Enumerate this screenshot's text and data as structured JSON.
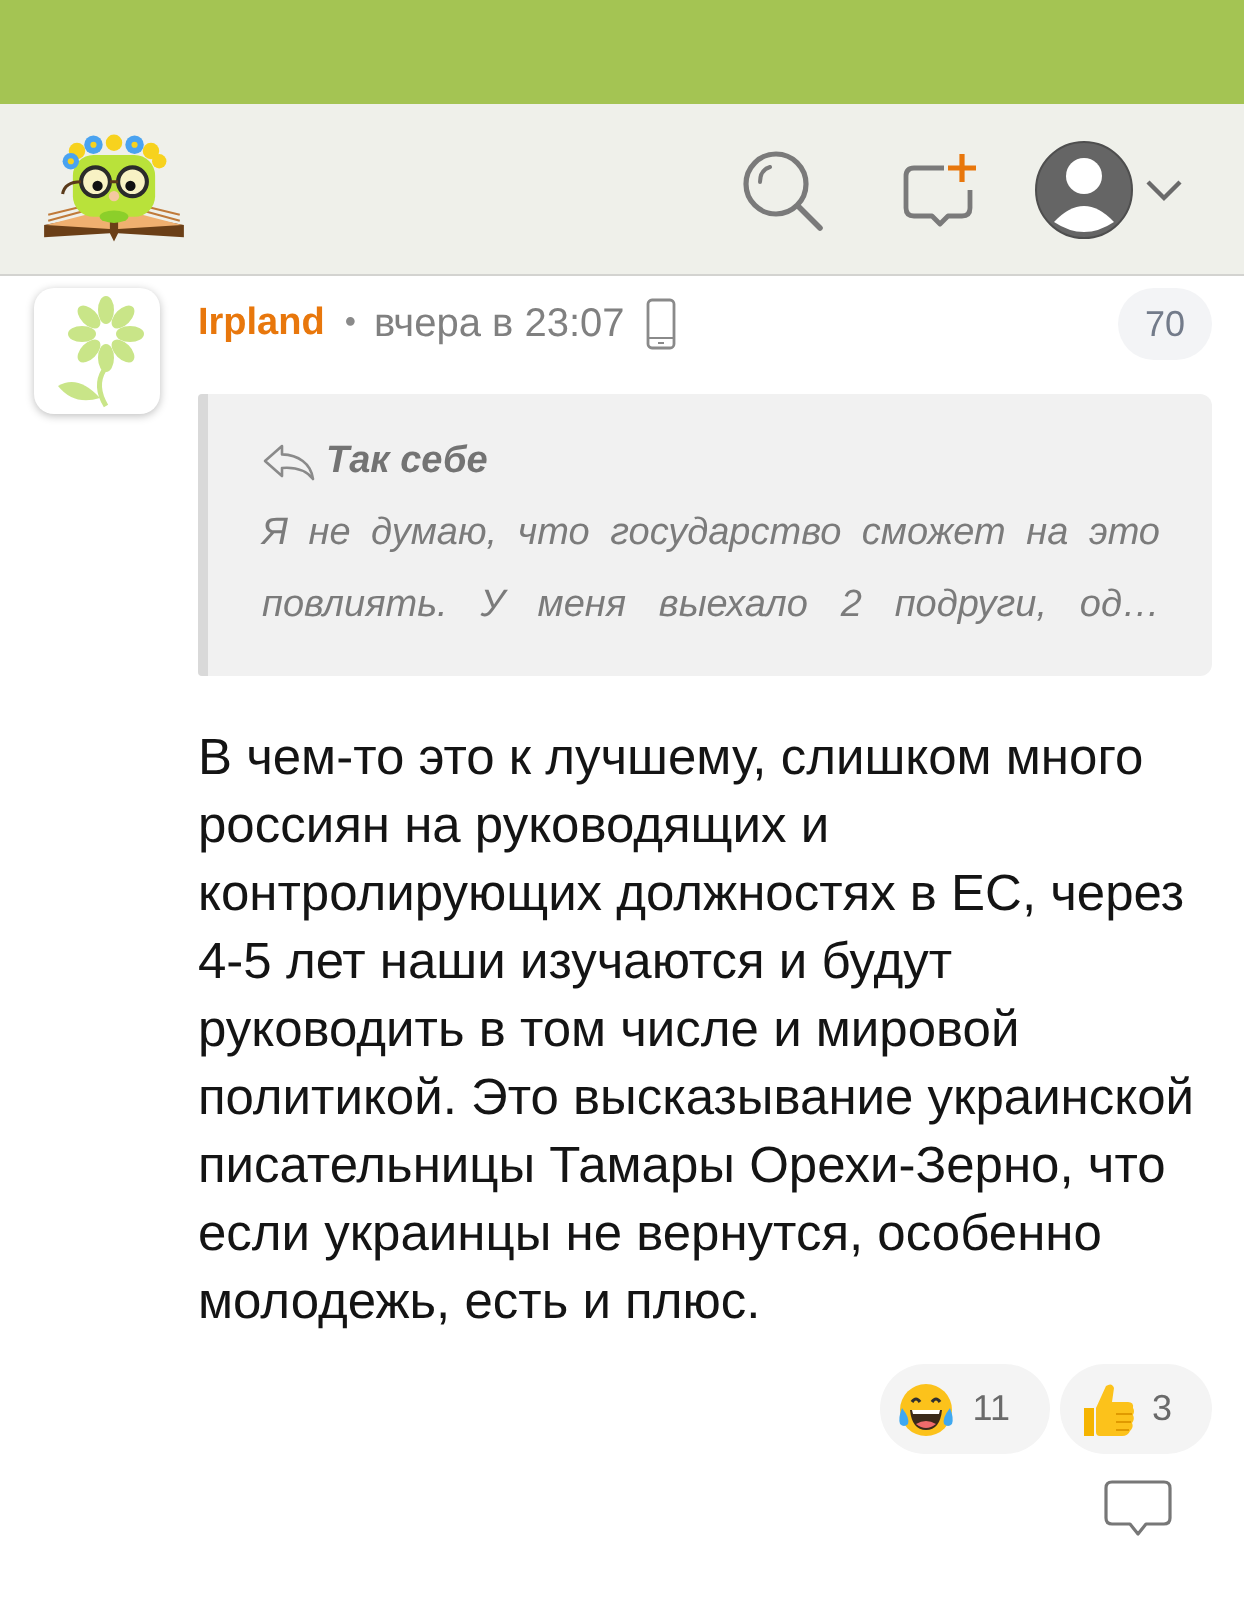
{
  "comment": {
    "author": "Irpland",
    "separator": "•",
    "time": "вчера в 23:07",
    "rating": "70",
    "quote": {
      "author": "Так себе",
      "text": "Я не думаю, что государство сможет на это повлиять. У меня выехало 2 подруги, од…"
    },
    "body": "В чем-то это к лучшему, слишком много россиян на руководящих и контролирующих должностях в ЕС, через 4-5 лет наши изучаются и будут руководить в том числе и мировой политикой. Это высказывание украинской писательницы Тамары Орехи-Зерно, что если украинцы не вернутся, особенно молодежь, есть и плюс.",
    "reactions": [
      {
        "kind": "laugh",
        "count": "11"
      },
      {
        "kind": "thumbs_up",
        "count": "3"
      }
    ]
  }
}
